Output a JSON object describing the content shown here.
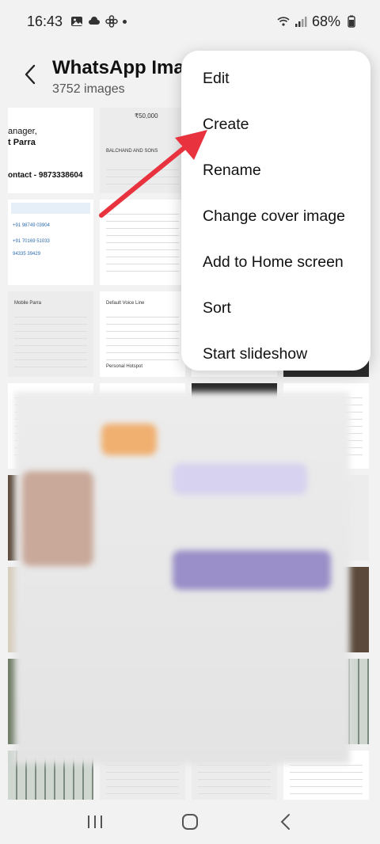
{
  "status_bar": {
    "time": "16:43",
    "battery": "68%",
    "icons_left": [
      "gallery-icon",
      "cloud-icon",
      "pinwheel-icon",
      "dot"
    ],
    "icons_right": [
      "wifi-icon",
      "signal-icon",
      "battery-icon"
    ]
  },
  "header": {
    "title": "WhatsApp Imag",
    "subtitle": "3752 images"
  },
  "tiles": {
    "t1_line1": "anager,",
    "t1_line2": "t Parra",
    "t1_line3": "ontact - 9873338604",
    "t2_amount": "₹50,000",
    "t2_payee": "BALCHAND AND SONS",
    "t3_mobile": "+91 98749 03904",
    "t3_phone": "+91 70169 51033",
    "t3_mobile2": "94335 39429",
    "t4_name": "Mobile Parra",
    "t5_voice": "Default Voice Line",
    "t5_hotspot": "Personal Hotspot"
  },
  "menu": {
    "items": [
      "Edit",
      "Create",
      "Rename",
      "Change cover image",
      "Add to Home screen",
      "Sort",
      "Start slideshow"
    ]
  },
  "colors": {
    "arrow": "#e8333f",
    "background": "#f2f2f2"
  }
}
